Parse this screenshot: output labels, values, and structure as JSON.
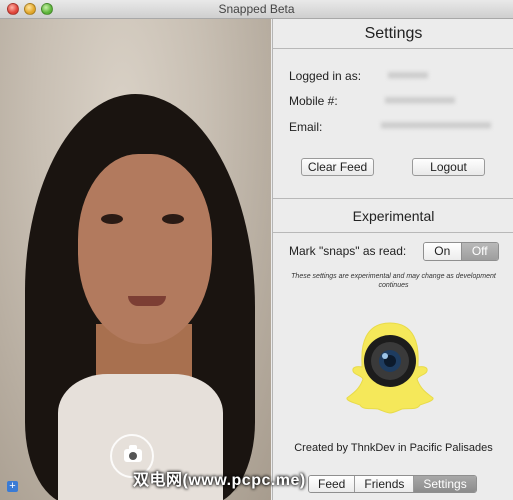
{
  "window": {
    "title": "Snapped Beta"
  },
  "settings": {
    "heading": "Settings",
    "logged_in_label": "Logged in as:",
    "mobile_label": "Mobile #:",
    "email_label": "Email:",
    "clear_feed_label": "Clear Feed",
    "logout_label": "Logout"
  },
  "experimental": {
    "heading": "Experimental",
    "mark_label": "Mark \"snaps\" as read:",
    "toggle_on": "On",
    "toggle_off": "Off",
    "toggle_selected": "Off",
    "note": "These settings are experimental and may change as development continues"
  },
  "credit": "Created by ThnkDev in Pacific Palisades",
  "tabs": [
    {
      "label": "Feed"
    },
    {
      "label": "Friends"
    },
    {
      "label": "Settings"
    }
  ],
  "active_tab": "Settings",
  "watermark": "双电网(www.pcpc.me)",
  "colors": {
    "snapchat_yellow": "#f5e85a",
    "accent_blue": "#3a7bd5"
  }
}
